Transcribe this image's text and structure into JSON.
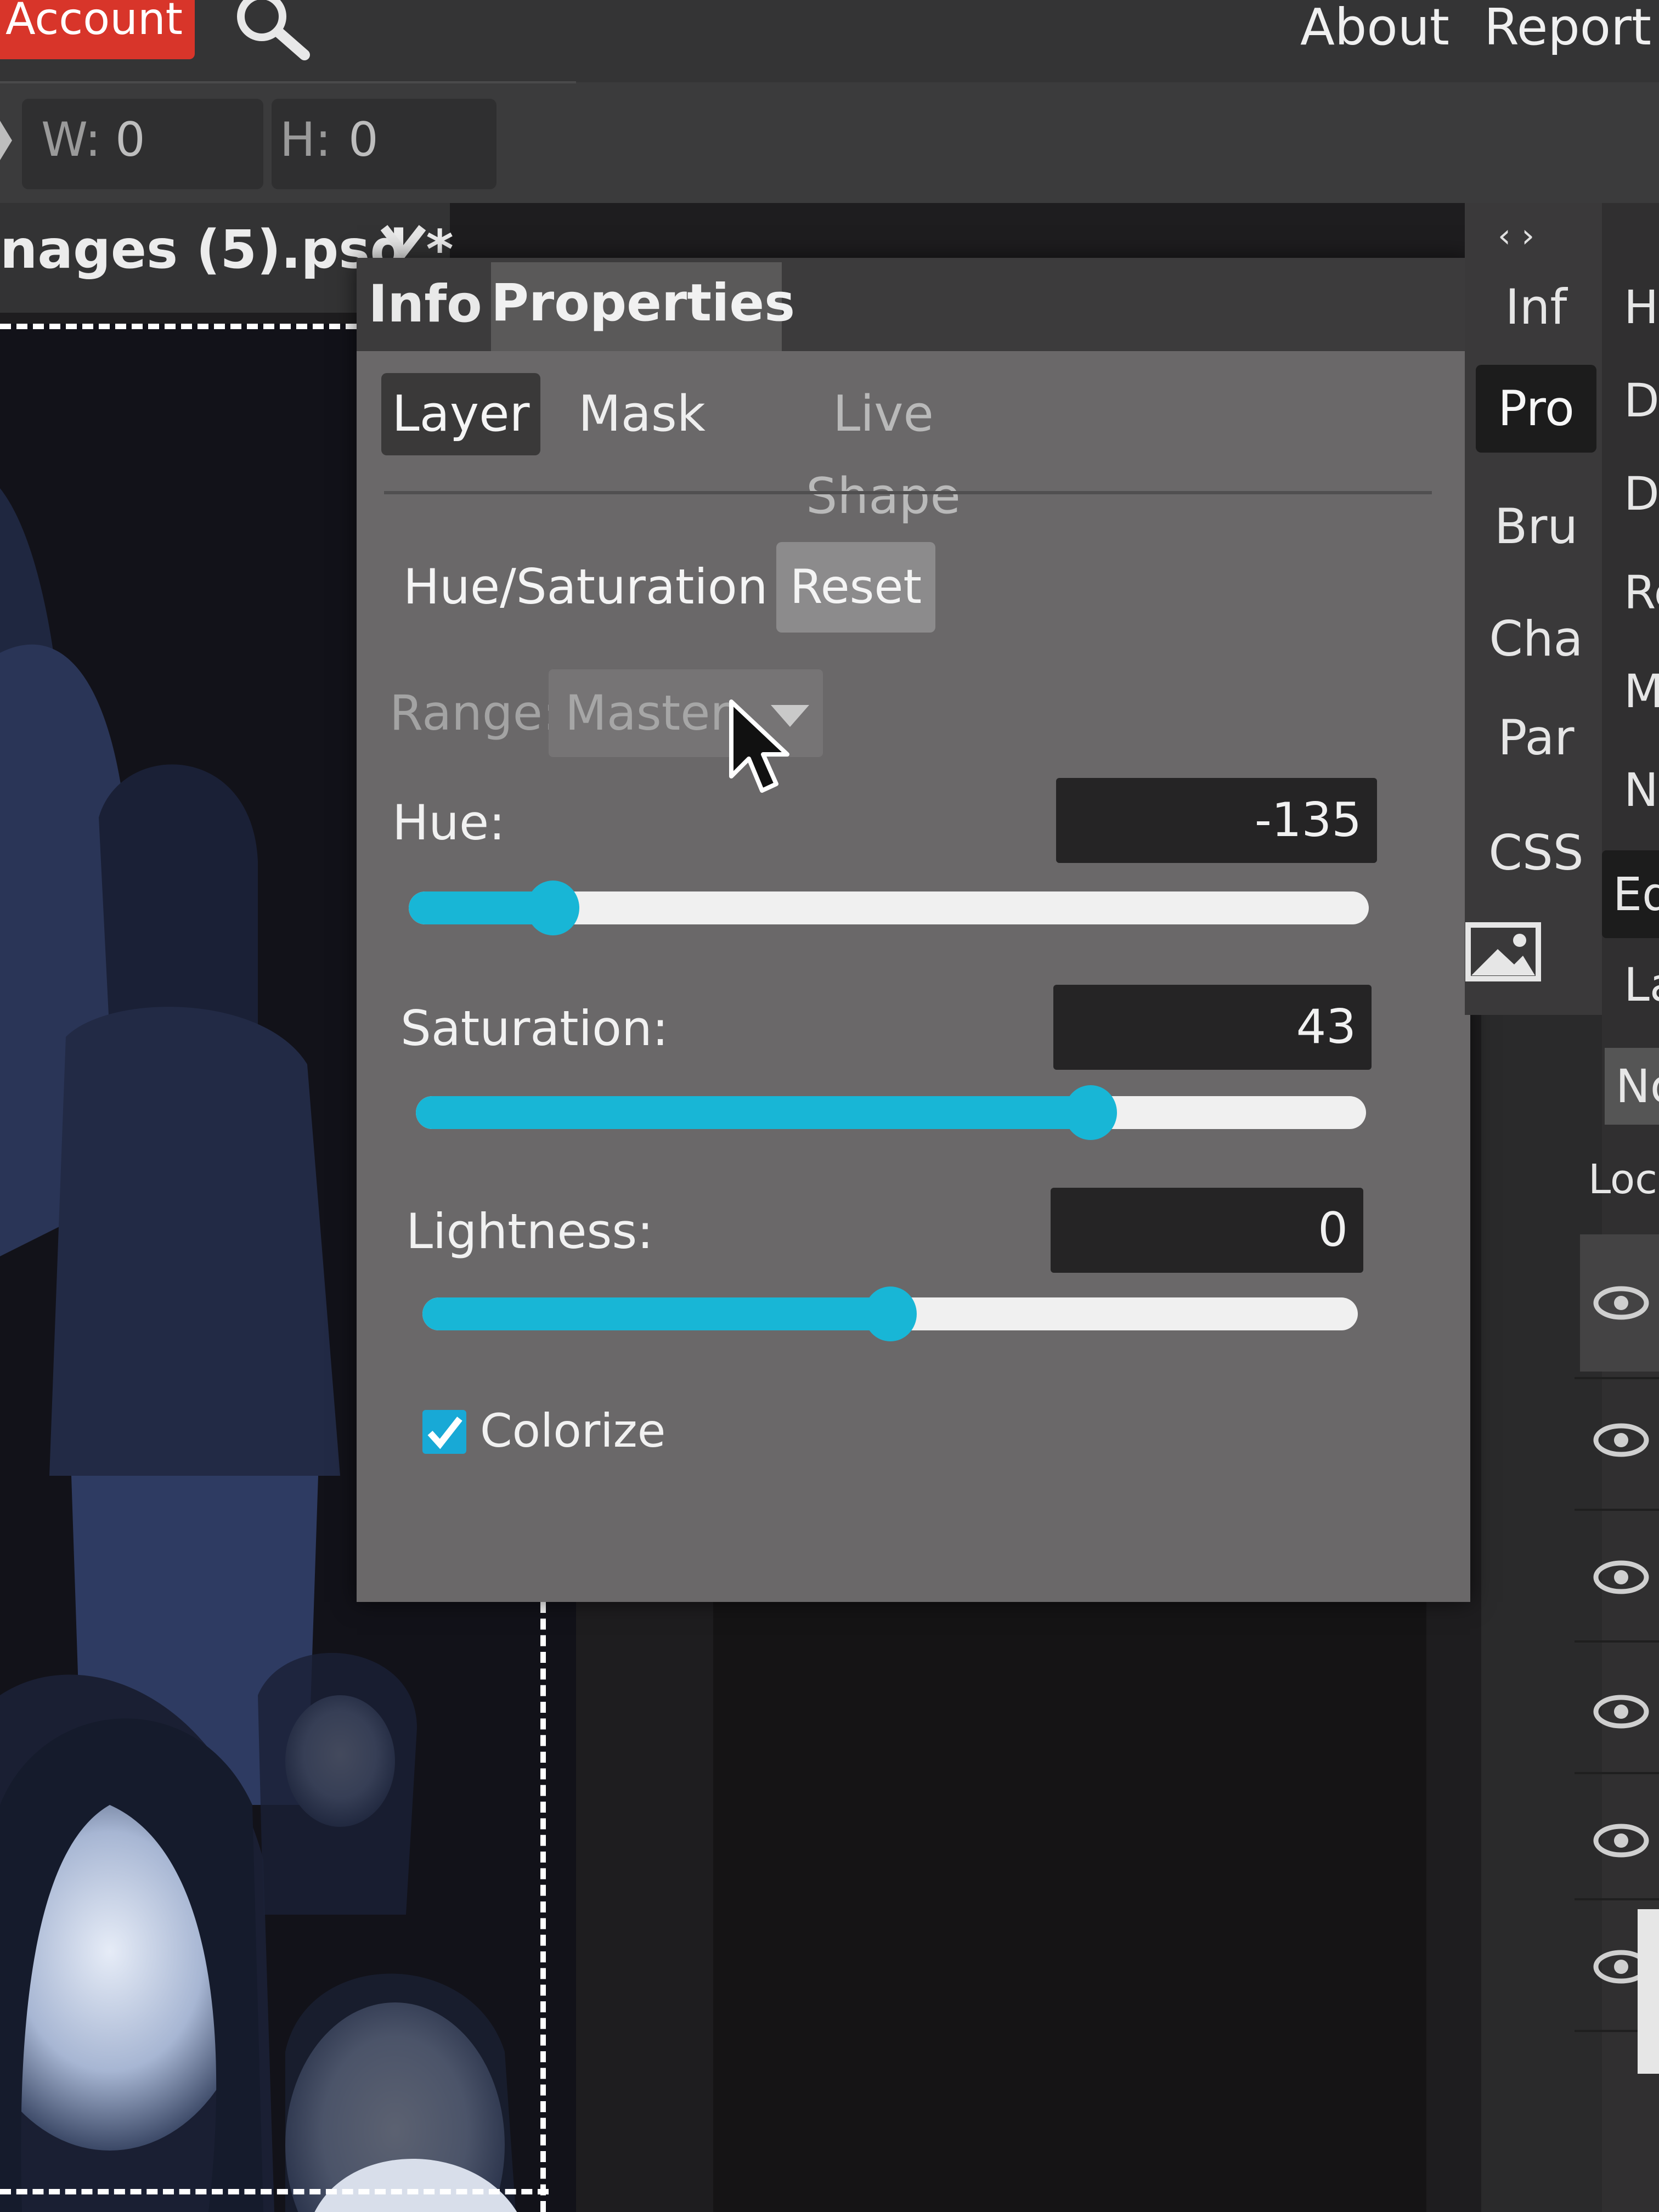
{
  "topbar": {
    "account_label": "Account",
    "about_label": "About",
    "report_label": "Report a"
  },
  "toolbar": {
    "w_label": "W:",
    "w_value": "0",
    "h_label": "H:",
    "h_value": "0"
  },
  "document": {
    "tab_label": "nages (5).psd *"
  },
  "panel": {
    "tabs": [
      "Info",
      "Properties"
    ],
    "subtabs": [
      "Layer",
      "Mask",
      "Live Shape"
    ],
    "adjustment_title": "Hue/Saturation",
    "reset_label": "Reset",
    "range": {
      "label": "Range:",
      "value": "Master"
    },
    "hue": {
      "label": "Hue:",
      "value": "-135",
      "level": 0.15
    },
    "saturation": {
      "label": "Saturation:",
      "value": "43",
      "level": 0.71
    },
    "lightness": {
      "label": "Lightness:",
      "value": "0",
      "level": 0.5
    },
    "colorize": {
      "label": "Colorize",
      "checked": true
    }
  },
  "right_strip": {
    "items": [
      "Inf",
      "Pro",
      "Bru",
      "Cha",
      "Par",
      "CSS"
    ]
  },
  "right_strip2": {
    "items": [
      "H",
      "D",
      "D",
      "Re",
      "M",
      "Ne",
      "Ed",
      "La",
      "No",
      "Loc"
    ]
  },
  "colors": {
    "accent": "#18b6d6",
    "account_red": "#d8352a",
    "panel_bg": "#6a6869"
  },
  "icons": [
    "search-icon",
    "chevron-down-icon",
    "cursor-icon",
    "image-icon",
    "eye-icon"
  ]
}
